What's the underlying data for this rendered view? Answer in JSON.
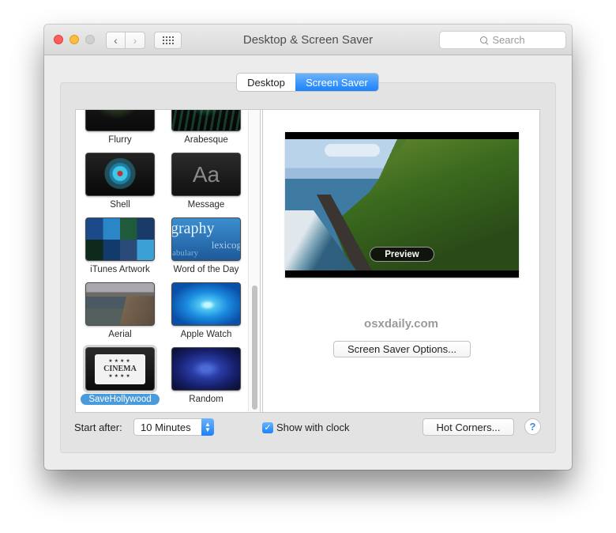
{
  "window": {
    "title": "Desktop & Screen Saver",
    "search_placeholder": "Search"
  },
  "toolbar": {
    "back_icon": "chevron-left-icon",
    "forward_icon": "chevron-right-icon",
    "show_all_icon": "grid-icon",
    "back_glyph": "‹",
    "forward_glyph": "›"
  },
  "tabs": [
    {
      "label": "Desktop",
      "selected": false
    },
    {
      "label": "Screen Saver",
      "selected": true
    }
  ],
  "screensavers": [
    {
      "label": "Flurry",
      "selected": false
    },
    {
      "label": "Arabesque",
      "selected": false
    },
    {
      "label": "Shell",
      "selected": false
    },
    {
      "label": "Message",
      "selected": false,
      "thumb_text": "Aa"
    },
    {
      "label": "iTunes Artwork",
      "selected": false
    },
    {
      "label": "Word of the Day",
      "selected": false,
      "thumb_words": [
        "graphy",
        "lexicog",
        "abulary"
      ]
    },
    {
      "label": "Aerial",
      "selected": false
    },
    {
      "label": "Apple Watch",
      "selected": false
    },
    {
      "label": "SaveHollywood",
      "selected": true,
      "thumb_text": "CINEMA",
      "thumb_stars": "★★★★"
    },
    {
      "label": "Random",
      "selected": false
    }
  ],
  "preview": {
    "button_label": "Preview",
    "watermark": "osxdaily.com",
    "options_button": "Screen Saver Options..."
  },
  "footer": {
    "start_after_label": "Start after:",
    "start_after_value": "10 Minutes",
    "show_clock_label": "Show with clock",
    "show_clock_checked": true,
    "checkmark": "✓",
    "hot_corners_button": "Hot Corners...",
    "help_button": "?"
  },
  "colors": {
    "accent": "#1a82fb",
    "selection": "#4a9bdc",
    "close": "#fc605c",
    "minimize": "#fdbc40",
    "zoom_disabled": "#d0d0d0"
  }
}
